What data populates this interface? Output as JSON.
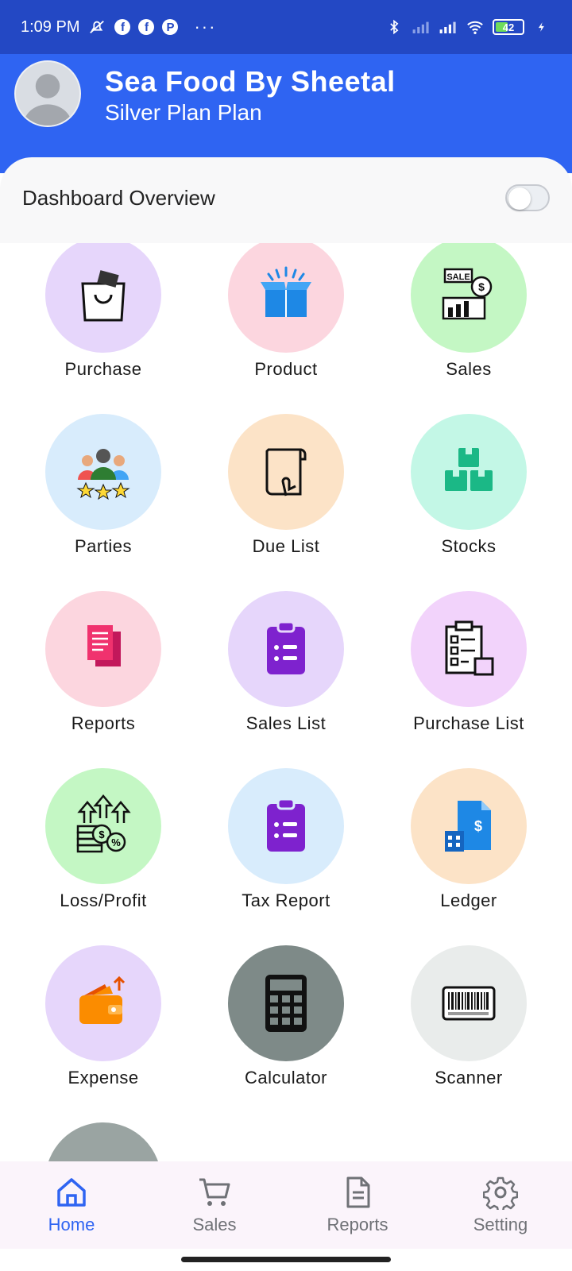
{
  "status_bar": {
    "time": "1:09 PM",
    "battery_level": "42",
    "icons": [
      "mute-icon",
      "facebook-icon",
      "facebook-icon",
      "app-icon",
      "more-dots-icon",
      "bluetooth-icon",
      "signal-icon",
      "signal-icon",
      "wifi-icon",
      "battery-icon",
      "charging-icon"
    ]
  },
  "header": {
    "title": "Sea Food By Sheetal",
    "subtitle": "Silver Plan Plan"
  },
  "overview": {
    "label": "Dashboard Overview",
    "toggle_on": false
  },
  "grid": {
    "items": [
      {
        "label": "Purchase",
        "icon": "shopping-bag-icon",
        "bg": "#e6d6fb"
      },
      {
        "label": "Product",
        "icon": "open-box-icon",
        "bg": "#fcd6df"
      },
      {
        "label": "Sales",
        "icon": "sales-report-icon",
        "bg": "#c4f7c4"
      },
      {
        "label": "Parties",
        "icon": "people-stars-icon",
        "bg": "#d8ecfc"
      },
      {
        "label": "Due List",
        "icon": "receipt-scroll-icon",
        "bg": "#fce3c7"
      },
      {
        "label": "Stocks",
        "icon": "stacked-boxes-icon",
        "bg": "#c3f7e6"
      },
      {
        "label": "Reports",
        "icon": "documents-icon",
        "bg": "#fcd6df"
      },
      {
        "label": "Sales List",
        "icon": "clipboard-list-icon",
        "bg": "#e6d6fb"
      },
      {
        "label": "Purchase List",
        "icon": "checklist-box-icon",
        "bg": "#f2d3fb"
      },
      {
        "label": "Loss/Profit",
        "icon": "money-growth-icon",
        "bg": "#c4f7c4"
      },
      {
        "label": "Tax Report",
        "icon": "clipboard-list-icon",
        "bg": "#d8ecfc"
      },
      {
        "label": "Ledger",
        "icon": "ledger-building-icon",
        "bg": "#fce3c7"
      },
      {
        "label": "Expense",
        "icon": "wallet-icon",
        "bg": "#e6d6fb"
      },
      {
        "label": "Calculator",
        "icon": "calculator-icon",
        "bg": "#7e8a88"
      },
      {
        "label": "Scanner",
        "icon": "barcode-icon",
        "bg": "#e9eceb"
      }
    ]
  },
  "bottom_nav": {
    "items": [
      {
        "label": "Home",
        "icon": "home-icon",
        "active": true
      },
      {
        "label": "Sales",
        "icon": "cart-icon",
        "active": false
      },
      {
        "label": "Reports",
        "icon": "document-icon",
        "active": false
      },
      {
        "label": "Setting",
        "icon": "gear-icon",
        "active": false
      }
    ]
  },
  "colors": {
    "status_bar": "#2348c4",
    "header": "#2f64f2",
    "accent": "#2f64f2",
    "nav_bg": "#fbf4fb"
  }
}
